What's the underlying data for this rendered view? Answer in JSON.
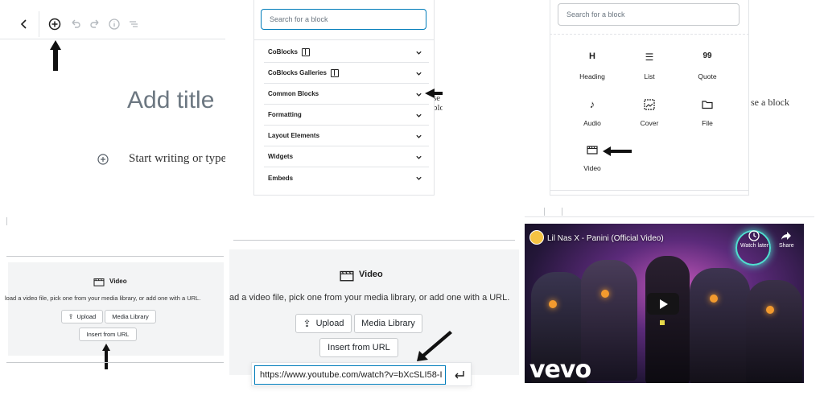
{
  "panel1": {
    "add_title": "Add title",
    "body_placeholder": "Start writing or type"
  },
  "panel2": {
    "search_placeholder": "Search for a block",
    "categories": [
      {
        "label": "CoBlocks"
      },
      {
        "label": "CoBlocks Galleries"
      },
      {
        "label": "Common Blocks"
      },
      {
        "label": "Formatting"
      },
      {
        "label": "Layout Elements"
      },
      {
        "label": "Widgets"
      },
      {
        "label": "Embeds"
      }
    ],
    "behind_text": "se a block"
  },
  "panel3": {
    "search_placeholder": "Search for a block",
    "blocks": [
      {
        "label": "Heading",
        "glyph": "H",
        "icon": "heading-icon"
      },
      {
        "label": "List",
        "glyph": "☰",
        "icon": "list-icon"
      },
      {
        "label": "Quote",
        "glyph": "99",
        "icon": "quote-icon"
      },
      {
        "label": "Audio",
        "glyph": "♪",
        "icon": "audio-icon"
      },
      {
        "label": "Cover",
        "glyph": "",
        "icon": "cover-icon"
      },
      {
        "label": "File",
        "glyph": "",
        "icon": "file-icon"
      },
      {
        "label": "Video",
        "glyph": "",
        "icon": "video-icon"
      }
    ],
    "behind_text": "se a block"
  },
  "panel4": {
    "title": "Video",
    "instructions": "load a video file, pick one from your media library, or add one with a URL.",
    "upload": "Upload",
    "media_library": "Media Library",
    "insert_url": "Insert from URL"
  },
  "panel5": {
    "title": "Video",
    "instructions": "ad a video file, pick one from your media library, or add one with a URL.",
    "upload": "Upload",
    "media_library": "Media Library",
    "insert_url": "Insert from URL",
    "url_value": "https://www.youtube.com/watch?v=bXcSLI58-I"
  },
  "panel6": {
    "video_title": "Lil Nas X - Panini (Official Video)",
    "watch_later": "Watch later",
    "share": "Share",
    "brand": "vevo"
  },
  "colors": {
    "arrow": "#111111",
    "border": "#e2e4e7",
    "placeholder_bg": "#f3f4f5",
    "focus_blue": "#007cba"
  }
}
